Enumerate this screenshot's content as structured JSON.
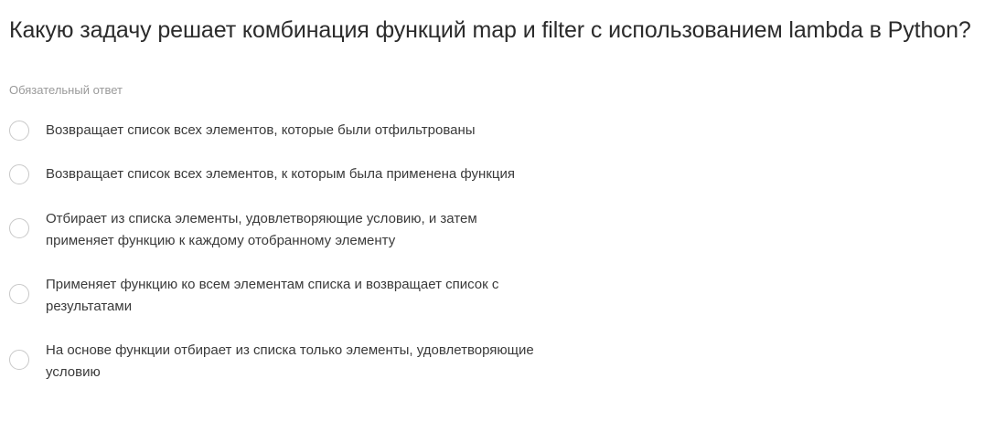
{
  "question": {
    "title": "Какую задачу решает комбинация функций map и filter с использованием lambda в Python?",
    "required_note": "Обязательный ответ"
  },
  "options": [
    {
      "label": "Возвращает список всех элементов, которые были отфильтрованы"
    },
    {
      "label": "Возвращает список всех элементов, к которым была применена функция"
    },
    {
      "label_line1": "Отбирает из списка элементы, удовлетворяющие условию, и затем",
      "label_line2": "применяет функцию к каждому отобранному элементу"
    },
    {
      "label_line1": "Применяет функцию ко всем элементам списка и возвращает список с",
      "label_line2": "результатами"
    },
    {
      "label_line1": "На основе функции отбирает из списка только элементы, удовлетворяющие",
      "label_line2": "условию"
    }
  ]
}
